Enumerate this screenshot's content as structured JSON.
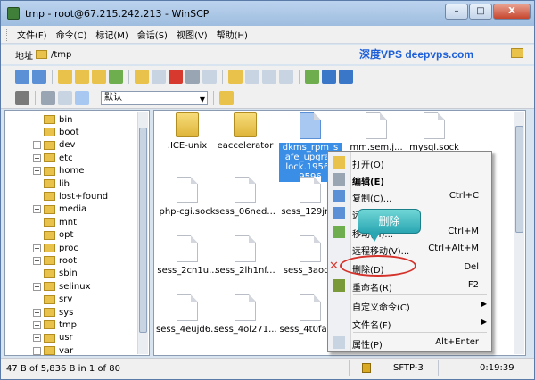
{
  "window": {
    "title": "tmp - root@67.215.242.213 - WinSCP",
    "buttons": [
      "–",
      "□",
      "X"
    ]
  },
  "menu": [
    "文件(F)",
    "命令(C)",
    "标记(M)",
    "会话(S)",
    "视图(V)",
    "帮助(H)"
  ],
  "address": {
    "label": "地址",
    "path": "/tmp"
  },
  "watermark": "深度VPS deepvps.com",
  "toolbar2": {
    "combo": "默认"
  },
  "tree": {
    "nodes": [
      {
        "name": "bin",
        "exp": false
      },
      {
        "name": "boot",
        "exp": false
      },
      {
        "name": "dev",
        "exp": true
      },
      {
        "name": "etc",
        "exp": true
      },
      {
        "name": "home",
        "exp": true
      },
      {
        "name": "lib",
        "exp": false
      },
      {
        "name": "lost+found",
        "exp": false
      },
      {
        "name": "media",
        "exp": true
      },
      {
        "name": "mnt",
        "exp": false
      },
      {
        "name": "opt",
        "exp": false
      },
      {
        "name": "proc",
        "exp": true
      },
      {
        "name": "root",
        "exp": true
      },
      {
        "name": "sbin",
        "exp": false
      },
      {
        "name": "selinux",
        "exp": true
      },
      {
        "name": "srv",
        "exp": false
      },
      {
        "name": "sys",
        "exp": true
      },
      {
        "name": "tmp",
        "exp": true
      },
      {
        "name": "usr",
        "exp": true
      },
      {
        "name": "var",
        "exp": true
      }
    ]
  },
  "files": [
    {
      "name": ".ICE-unix",
      "type": "folder"
    },
    {
      "name": "eaccelerator",
      "type": "folder"
    },
    {
      "name": "dkms_rpm_s afe_upgrad lock.19562 9596",
      "type": "file",
      "selected": true
    },
    {
      "name": "mm.sem.j...",
      "type": "file"
    },
    {
      "name": "mysql.sock",
      "type": "file"
    },
    {
      "name": "php-cgi.sock",
      "type": "file"
    },
    {
      "name": "sess_06ned...",
      "type": "file"
    },
    {
      "name": "sess_129jrr...",
      "type": "file"
    },
    {
      "name": "sess_2cn1u...",
      "type": "file"
    },
    {
      "name": "sess_2lh1nf...",
      "type": "file"
    },
    {
      "name": "sess_3aoc...",
      "type": "file"
    },
    {
      "name": "sess_4eujd6...",
      "type": "file"
    },
    {
      "name": "sess_4ol271...",
      "type": "file"
    },
    {
      "name": "sess_4t0fa9...",
      "type": "file"
    }
  ],
  "context_menu": {
    "items": [
      {
        "label": "打开(O)",
        "key": "",
        "icon": "open-icon",
        "bold": false
      },
      {
        "label": "编辑(E)",
        "key": "",
        "icon": "edit-icon",
        "bold": true
      },
      {
        "label": "复制(C)...",
        "key": "Ctrl+C",
        "icon": "copy-icon",
        "bold": false
      },
      {
        "label": "远程复制(Y)...",
        "key": "",
        "icon": "remote-copy-icon",
        "bold": false
      },
      {
        "label": "移动(M)...",
        "key": "Ctrl+M",
        "icon": "move-icon",
        "bold": false
      },
      {
        "label": "远程移动(V)...",
        "key": "Ctrl+Alt+M",
        "icon": "",
        "bold": false
      },
      {
        "label": "删除(D)",
        "key": "Del",
        "icon": "delete-icon",
        "bold": false
      },
      {
        "label": "重命名(R)",
        "key": "F2",
        "icon": "rename-icon",
        "bold": false
      },
      {
        "label": "自定义命令(C)",
        "key": "",
        "icon": "",
        "bold": false,
        "submenu": true
      },
      {
        "label": "文件名(F)",
        "key": "",
        "icon": "",
        "bold": false,
        "submenu": true
      },
      {
        "label": "属性(P)",
        "key": "Alt+Enter",
        "icon": "properties-icon",
        "bold": false
      }
    ]
  },
  "callout": "删除",
  "status": {
    "selection": "47 B of 5,836 B in 1 of 80",
    "protocol": "SFTP-3",
    "time": "0:19:39"
  },
  "colors": {
    "accent": "#3a8ee6",
    "watermark": "#1c5fd8",
    "highlight": "#d4322a",
    "callout": "#2aa6b2"
  }
}
